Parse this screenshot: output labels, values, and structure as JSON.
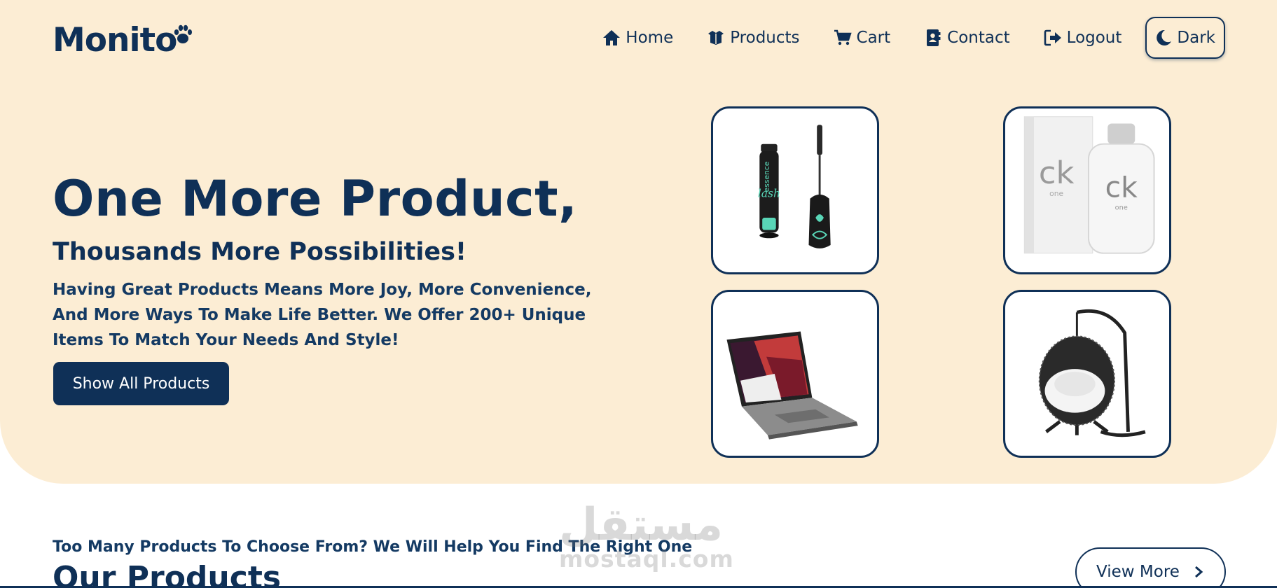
{
  "brand": {
    "name": "Monito"
  },
  "nav": {
    "items": [
      {
        "label": "Home",
        "icon": "home-icon"
      },
      {
        "label": "Products",
        "icon": "box-open-icon"
      },
      {
        "label": "Cart",
        "icon": "cart-icon"
      },
      {
        "label": "Contact",
        "icon": "address-book-icon"
      },
      {
        "label": "Logout",
        "icon": "logout-icon"
      }
    ],
    "theme_toggle": {
      "label": "Dark",
      "icon": "moon-icon"
    }
  },
  "hero": {
    "title": "One More Product,",
    "subtitle": "Thousands More Possibilities!",
    "description": "Having Great Products Means More Joy, More Convenience, And More Ways To Make Life Better. We Offer 200+ Unique Items To Match Your Needs And Style!",
    "cta_label": "Show All Products",
    "products": [
      {
        "name": "mascara",
        "brand_text": "essence",
        "product_text": "lash"
      },
      {
        "name": "perfume",
        "brand_text": "ck",
        "product_text": "one"
      },
      {
        "name": "laptop"
      },
      {
        "name": "hanging chair"
      }
    ]
  },
  "products_section": {
    "tagline": "Too Many Products To Choose From? We Will Help You Find The Right One",
    "title": "Our Products",
    "view_more_label": "View More"
  },
  "watermark": {
    "arabic": "مستقل",
    "latin": "mostaql.com"
  },
  "colors": {
    "navy": "#0f3057",
    "cream": "#fcedd4",
    "white": "#ffffff"
  }
}
